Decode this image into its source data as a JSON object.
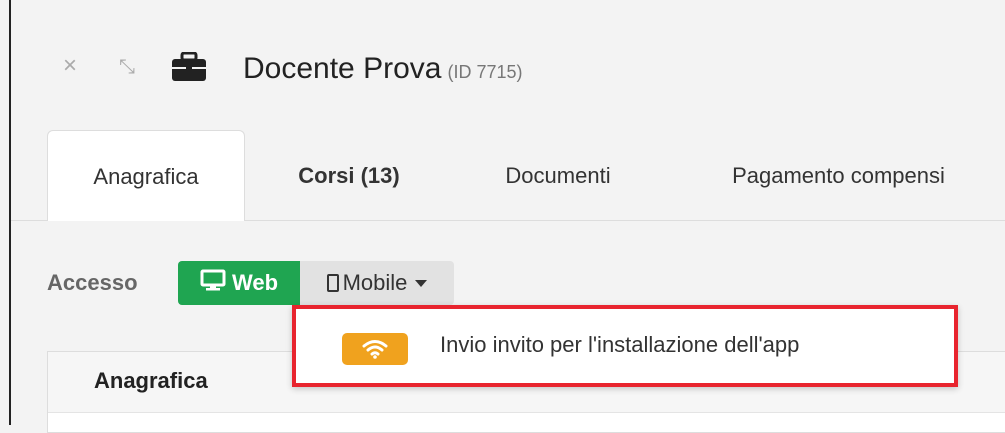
{
  "header": {
    "title": "Docente Prova",
    "id_label": "(ID 7715)",
    "close_glyph": "×",
    "minimize_glyph": "⤡"
  },
  "tabs": [
    {
      "label": "Anagrafica",
      "active": true,
      "bold": false
    },
    {
      "label": "Corsi (13)",
      "active": false,
      "bold": true
    },
    {
      "label": "Documenti",
      "active": false,
      "bold": false
    },
    {
      "label": "Pagamento compensi",
      "active": false,
      "bold": false
    }
  ],
  "access": {
    "label": "Accesso",
    "web_label": "Web",
    "mobile_label": "Mobile"
  },
  "dropdown": {
    "items": [
      {
        "label": "Invio invito per l'installazione dell'app",
        "icon": "wifi-icon"
      }
    ]
  },
  "panel": {
    "title": "Anagrafica"
  },
  "colors": {
    "web_green": "#1fa551",
    "wifi_orange": "#f0a21e",
    "highlight_red": "#e8242e"
  }
}
